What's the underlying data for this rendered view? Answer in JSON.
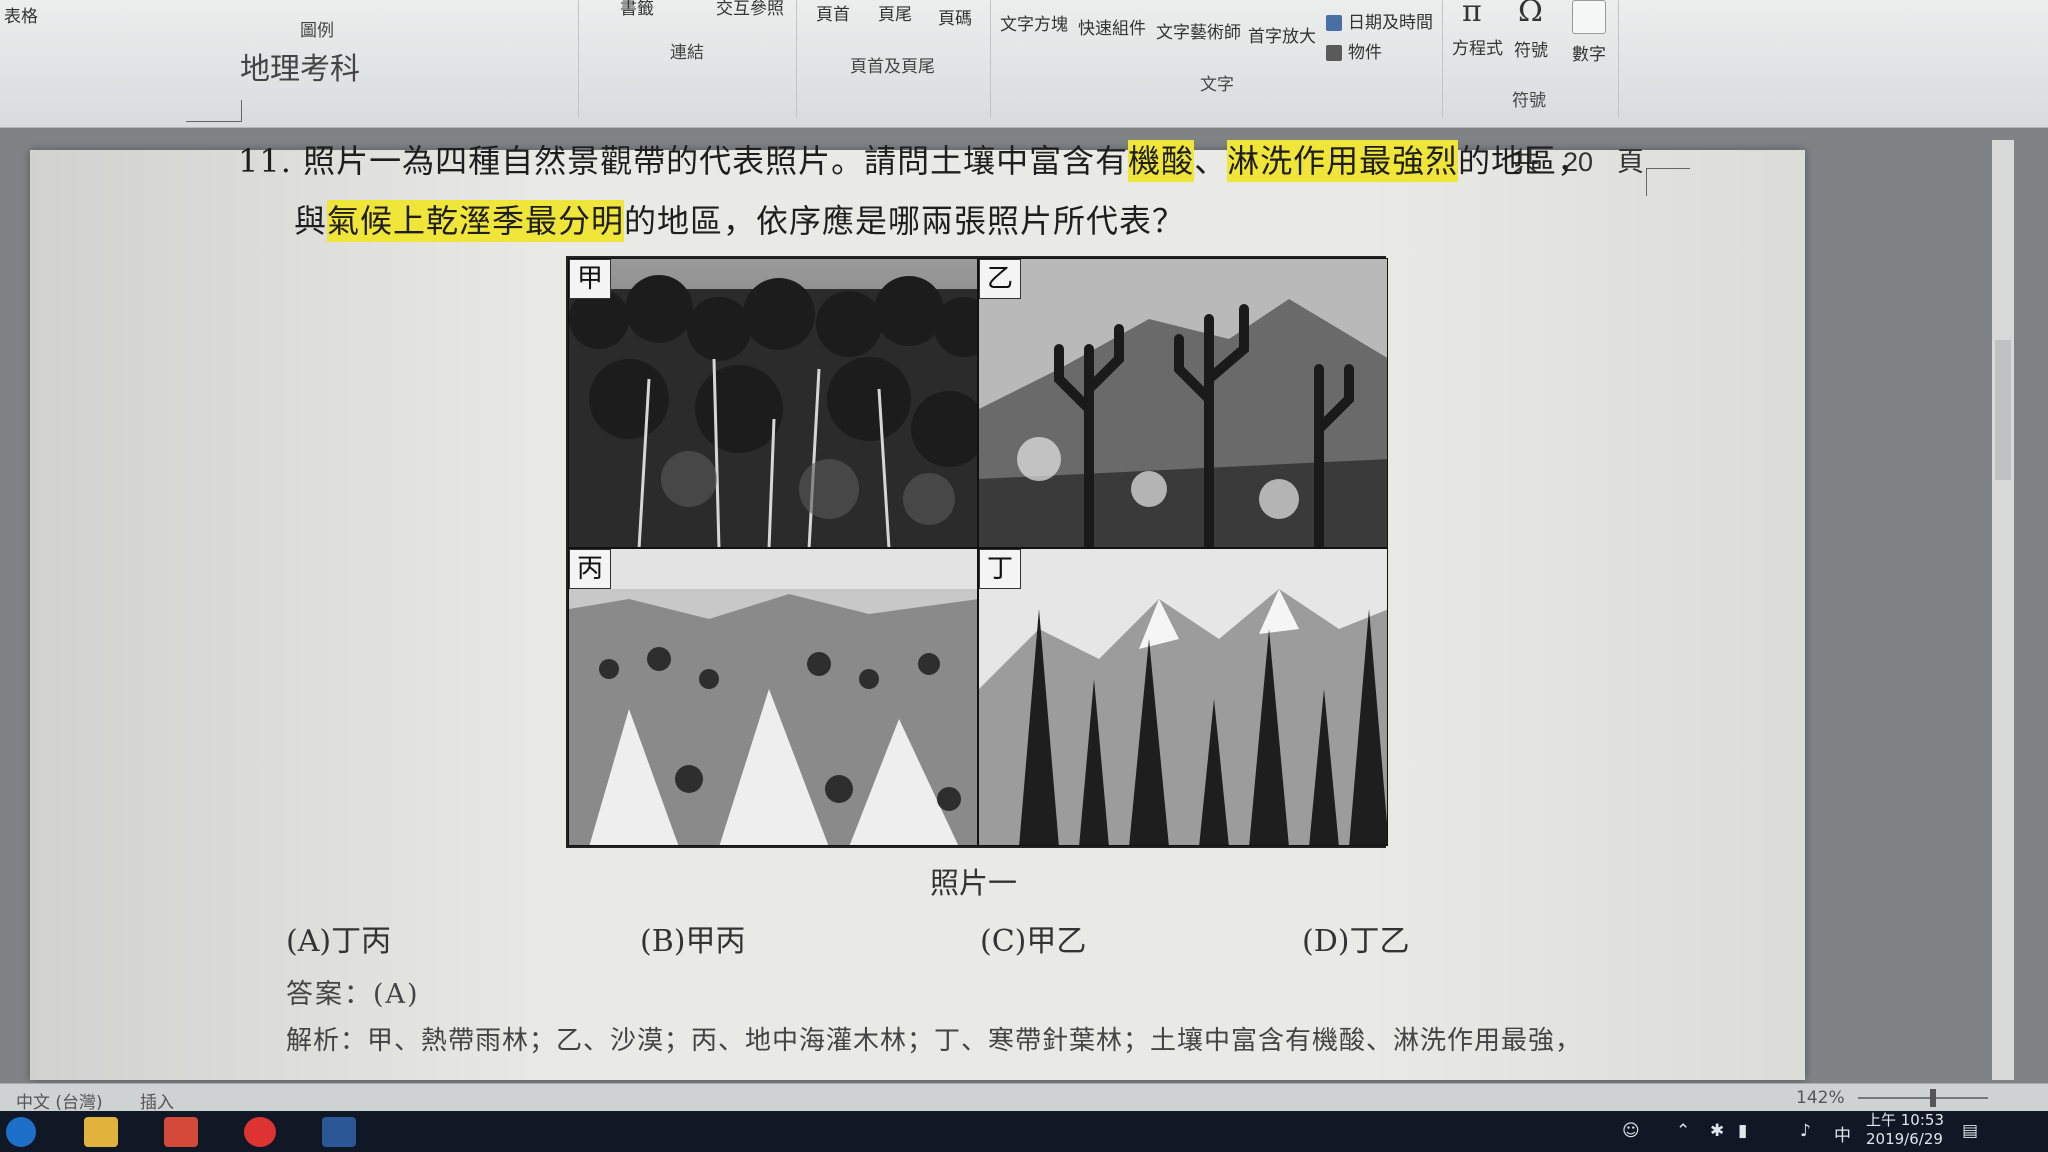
{
  "ribbon": {
    "tab_table": "表格",
    "group_illustrations": "圖例",
    "btn_cross_ref": "交互參照",
    "btn_bookmark": "書籤",
    "group_links": "連結",
    "btn_header": "頁首",
    "btn_footer": "頁尾",
    "btn_page_number": "頁碼",
    "group_header_footer": "頁首及頁尾",
    "btn_text_box": "文字方塊",
    "btn_quick_parts": "快速組件",
    "btn_wordart": "文字藝術師",
    "btn_drop_cap": "首字放大",
    "btn_date_time": "日期及時間",
    "btn_object": "物件",
    "group_text": "文字",
    "btn_equation": "方程式",
    "btn_symbol": "符號",
    "btn_number": "數字",
    "group_symbols": "符號",
    "equation_glyph": "π",
    "symbol_glyph": "Ω"
  },
  "document": {
    "subject": "地理考科",
    "page_count_prefix": "共",
    "page_count_number": "20",
    "page_count_suffix": "頁",
    "question_number": "11.",
    "line1_text": "照片一為四種自然景觀帶的代表照片。請問土壤中富含有",
    "line1_hl1": "機酸",
    "line1_sep": "、",
    "line1_hl2": "淋洗作用最強烈",
    "line1_end": "的地區，",
    "line2_start": "與",
    "line2_hl": "氣候上乾溼季最分明",
    "line2_end": "的地區，依序應是哪兩張照片所代表？",
    "photos": [
      {
        "label": "甲"
      },
      {
        "label": "乙"
      },
      {
        "label": "丙"
      },
      {
        "label": "丁"
      }
    ],
    "caption": "照片一",
    "options": [
      "(A)丁丙",
      "(B)甲丙",
      "(C)甲乙",
      "(D)丁乙"
    ],
    "answer": "答案：(A)",
    "explanation": "解析：甲、熱帶雨林；乙、沙漠；丙、地中海灌木林；丁、寒帶針葉林；土壤中富含有機酸、淋洗作用最強，"
  },
  "status": {
    "language": "中文 (台灣)",
    "insert_mode": "插入",
    "zoom": "142%"
  },
  "taskbar": {
    "time": "上午 10:53",
    "date": "2019/6/29",
    "ime": "中"
  },
  "colors": {
    "highlight": "#f0e63a",
    "taskbar": "#101826",
    "page": "#e9e9e6"
  }
}
